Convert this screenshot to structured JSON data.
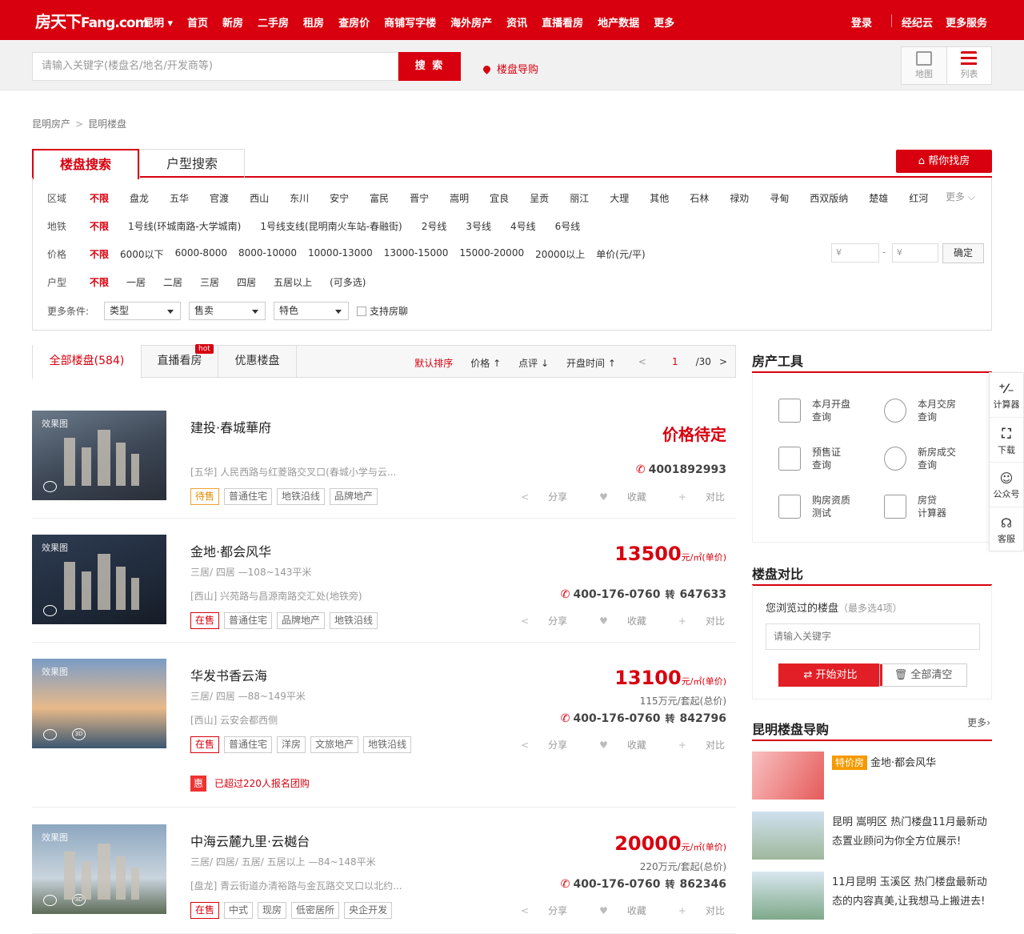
{
  "header": {
    "logo_cn": "房天下",
    "logo_en": "Fang.com",
    "city": "昆明",
    "nav": [
      "首页",
      "新房",
      "二手房",
      "租房",
      "查房价",
      "商铺写字楼",
      "海外房产",
      "资讯",
      "直播看房",
      "地产数据",
      "更多"
    ],
    "login": "登录",
    "broker": "经纪云",
    "more_services": "更多服务"
  },
  "search": {
    "placeholder": "请输入关键字(楼盘名/地名/开发商等)",
    "button": "搜 索",
    "guide": "楼盘导购",
    "map": "地图",
    "list": "列表"
  },
  "breadcrumb": [
    "昆明房产",
    "昆明楼盘"
  ],
  "tabs": {
    "t1": "楼盘搜索",
    "t2": "户型搜索",
    "help": "帮你找房"
  },
  "filter": {
    "area_label": "区域",
    "area": [
      "不限",
      "盘龙",
      "五华",
      "官渡",
      "西山",
      "东川",
      "安宁",
      "富民",
      "晋宁",
      "嵩明",
      "宜良",
      "呈贡",
      "丽江",
      "大理",
      "其他",
      "石林",
      "禄劝",
      "寻甸",
      "西双版纳",
      "楚雄",
      "红河"
    ],
    "more": "更多",
    "metro_label": "地铁",
    "metro": [
      "不限",
      "1号线(环城南路-大学城南)",
      "1号线支线(昆明南火车站-春融街)",
      "2号线",
      "3号线",
      "4号线",
      "6号线"
    ],
    "price_label": "价格",
    "price": [
      "不限",
      "6000以下",
      "6000-8000",
      "8000-10000",
      "10000-13000",
      "13000-15000",
      "15000-20000",
      "20000以上",
      "单价(元/平)"
    ],
    "price_min": "¥",
    "price_max": "¥",
    "confirm": "确定",
    "room_label": "户型",
    "rooms": [
      "不限",
      "一居",
      "二居",
      "三居",
      "四居",
      "五居以上",
      "(可多选)"
    ],
    "more_label": "更多条件:",
    "sel_type": "类型",
    "sel_sale": "售卖",
    "sel_feature": "特色",
    "chat": "支持房聊"
  },
  "list_tabs": {
    "all": "全部楼盘(584)",
    "live": "直播看房",
    "hot": "hot",
    "discount": "优惠楼盘",
    "sort_default": "默认排序",
    "sort_price": "价格 ↑",
    "sort_review": "点评 ↓",
    "sort_open": "开盘时间 ↑",
    "page_cur": "1",
    "page_total": "/30",
    "prev": "<",
    "next": ">"
  },
  "listings": [
    {
      "name": "建投·春城華府",
      "price_text": "价格待定",
      "address": "[五华] 人民西路与红菱路交叉口(春城小学与云...",
      "phone": "4001892993",
      "ext": "",
      "rooms": "",
      "total": "",
      "tags": [
        "待售",
        "普通住宅",
        "地铁沿线",
        "品牌地产"
      ],
      "img_tag": "效果图"
    },
    {
      "name": "金地·都会风华",
      "price": "13500",
      "unit": "元/㎡(单价)",
      "rooms": "三居/ 四居 —108~143平米",
      "address": "[西山] 兴苑路与昌源南路交汇处(地铁旁)",
      "phone": "400-176-0760",
      "ext": "647633",
      "total": "",
      "tags": [
        "在售",
        "普通住宅",
        "品牌地产",
        "地铁沿线"
      ],
      "img_tag": "效果图"
    },
    {
      "name": "华发书香云海",
      "price": "13100",
      "unit": "元/㎡(单价)",
      "rooms": "三居/ 四居 —88~149平米",
      "address": "[西山] 云安会都西侧",
      "phone": "400-176-0760",
      "ext": "842796",
      "total": "115万元/套起(总价)",
      "tags": [
        "在售",
        "普通住宅",
        "洋房",
        "文旅地产",
        "地铁沿线"
      ],
      "img_tag": "效果图",
      "promo_badge": "惠",
      "promo": "已超过220人报名团购"
    },
    {
      "name": "中海云麓九里·云樾台",
      "price": "20000",
      "unit": "元/㎡(单价)",
      "rooms": "三居/ 四居/ 五居/ 五居以上 —84~148平米",
      "address": "[盘龙] 青云街道办清裕路与金瓦路交叉口以北约...",
      "phone": "400-176-0760",
      "ext": "862346",
      "total": "220万元/套起(总价)",
      "tags": [
        "在售",
        "中式",
        "现房",
        "低密居所",
        "央企开发"
      ],
      "img_tag": "效果图"
    }
  ],
  "actions": {
    "share": "分享",
    "fav": "收藏",
    "compare": "对比",
    "zhuan": "转"
  },
  "tools": {
    "title": "房产工具",
    "items": [
      "本月开盘|查询",
      "本月交房|查询",
      "预售证|查询",
      "新房成交|查询",
      "购房资质|测试",
      "房贷|计算器"
    ]
  },
  "compare": {
    "title": "楼盘对比",
    "hint": "您浏览过的楼盘",
    "hint_sub": "（最多选4项）",
    "placeholder": "请输入关键字",
    "start": "开始对比",
    "clear": "全部清空"
  },
  "guide": {
    "title": "昆明楼盘导购",
    "more": "更多",
    "items": [
      {
        "badge": "特价房",
        "text": "金地·都会风华"
      },
      {
        "text": "昆明 嵩明区 热门楼盘11月最新动态置业顾问为你全方位展示!"
      },
      {
        "text": "11月昆明 玉溪区 热门楼盘最新动态的内容真美,让我想马上搬进去!"
      }
    ]
  },
  "sidebar": [
    "计算器",
    "下载",
    "公众号",
    "客服"
  ],
  "colors": {
    "brand": "#d8000f"
  }
}
